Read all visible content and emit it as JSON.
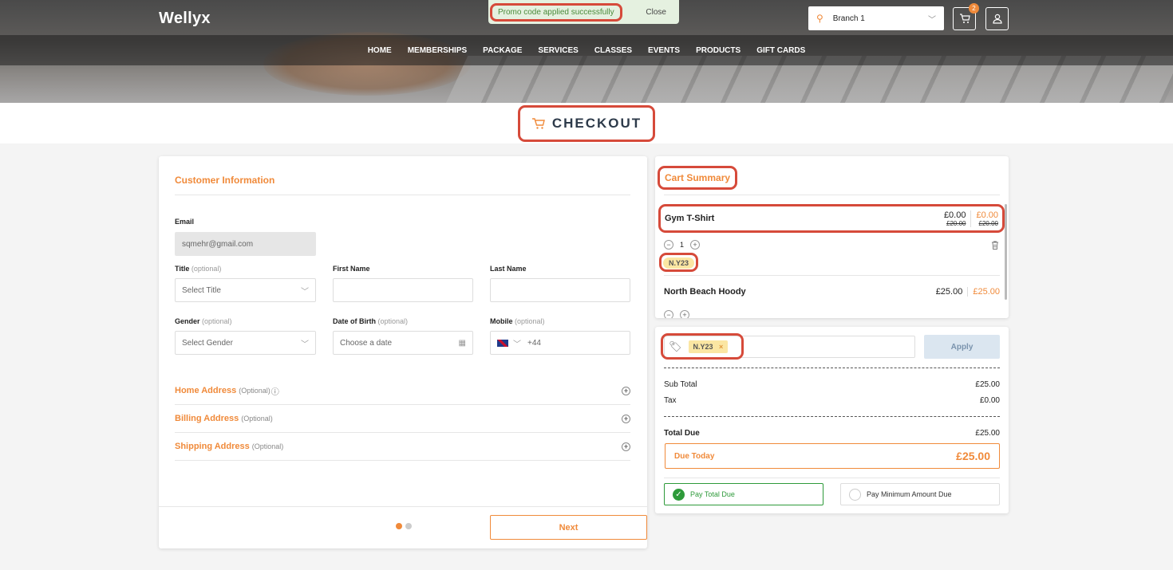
{
  "header": {
    "logo": "Wellyx",
    "nav": [
      "HOME",
      "MEMBERSHIPS",
      "PACKAGE",
      "SERVICES",
      "CLASSES",
      "EVENTS",
      "PRODUCTS",
      "GIFT CARDS"
    ],
    "branch": "Branch 1",
    "cart_count": "2"
  },
  "toast": {
    "message": "Promo code applied successfully",
    "close_label": "Close"
  },
  "page_title": "CHECKOUT",
  "customer": {
    "title": "Customer Information",
    "email_label": "Email",
    "email_value": "sqmehr@gmail.com",
    "title_label": "Title",
    "optional": "(optional)",
    "title_placeholder": "Select Title",
    "first_name_label": "First Name",
    "last_name_label": "Last Name",
    "gender_label": "Gender",
    "gender_placeholder": "Select Gender",
    "dob_label": "Date of Birth",
    "dob_placeholder": "Choose a date",
    "mobile_label": "Mobile",
    "mobile_code": "+44",
    "optional_cap": "(Optional)",
    "home_address": "Home Address",
    "billing_address": "Billing Address",
    "shipping_address": "Shipping Address",
    "next_label": "Next"
  },
  "cart": {
    "title": "Cart Summary",
    "items": [
      {
        "name": "Gym T-Shirt",
        "price": "£0.00",
        "price_orange": "£0.00",
        "old_price": "£20.00",
        "old_price2": "£20.00",
        "qty": "1",
        "promo": "N.Y23"
      },
      {
        "name": "North Beach Hoody",
        "price": "£25.00",
        "price_orange": "£25.00"
      }
    ]
  },
  "summary": {
    "promo_code": "N.Y23",
    "apply_label": "Apply",
    "subtotal_label": "Sub Total",
    "subtotal": "£25.00",
    "tax_label": "Tax",
    "tax": "£0.00",
    "total_due_label": "Total Due",
    "total_due": "£25.00",
    "due_today_label": "Due Today",
    "due_today": "£25.00",
    "pay_total": "Pay Total Due",
    "pay_min": "Pay Minimum Amount Due"
  }
}
